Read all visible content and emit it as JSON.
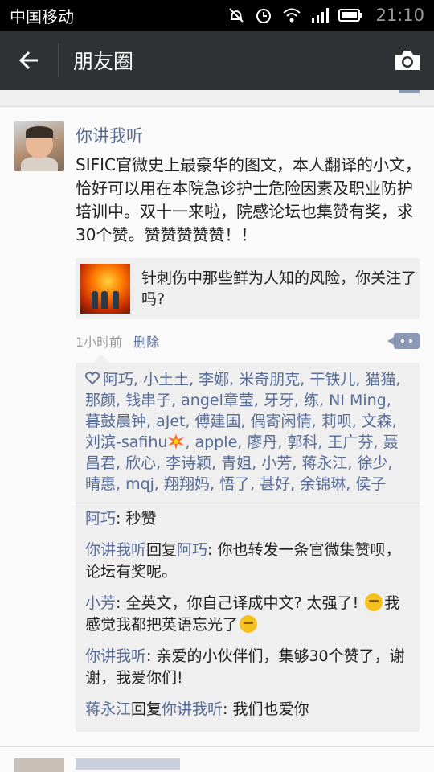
{
  "status": {
    "carrier": "中国移动",
    "time": "21:10"
  },
  "header": {
    "title": "朋友圈"
  },
  "post": {
    "username": "你讲我听",
    "text": "SIFIC官微史上最豪华的图文，本人翻译的小文，恰好可以用在本院急诊护士危险因素及职业防护培训中。双十一来啦，院感论坛也集赞有奖，求30个赞。赞赞赞赞赞！！",
    "link_title": "针刺伤中那些鲜为人知的风险，你关注了吗?",
    "time": "1小时前",
    "delete_label": "删除",
    "likes_part1": "阿巧, 小土土, 李娜, 米奇朋克, 干铁儿, 猫猫, 那颜, 钱串子, angel章莹, 牙牙, 练, NI Ming, 暮鼓晨钟, aJet, 傅建国, 偶寄闲情, 莉呗, 文森, 刘滨-safihu",
    "likes_part2": ", apple, 廖丹, 郭科, 王广芬, 聂昌君, 欣心, 李诗颖, 青姐, 小芳, 蒋永江, 徐少, 晴惠, mqj, 翔翔妈, 悟了, 甚好, 余锦琳, 侯子",
    "comments": [
      {
        "name": "阿巧",
        "sep": ": ",
        "text": "秒赞"
      },
      {
        "name": "你讲我听",
        "reply_word": "回复",
        "reply_to": "阿巧",
        "sep": ": ",
        "text": "你也转发一条官微集赞呗，论坛有奖呢。"
      },
      {
        "name": "小芳",
        "sep": ": ",
        "text_a": "全英文，你自己译成中文? 太强了! ",
        "text_b": "我感觉我都把英语忘光了"
      },
      {
        "name": "你讲我听",
        "sep": ": ",
        "text": "亲爱的小伙伴们，集够30个赞了，谢谢，我爱你们!"
      },
      {
        "name": "蒋永江",
        "reply_word": "回复",
        "reply_to": "你讲我听",
        "sep": ": ",
        "text": "我们也爱你"
      }
    ]
  },
  "colors": {
    "link": "#576b95",
    "titlebar": "#2f3135"
  },
  "icons": [
    "back-arrow-icon",
    "camera-icon",
    "heart-icon",
    "more-icon"
  ]
}
